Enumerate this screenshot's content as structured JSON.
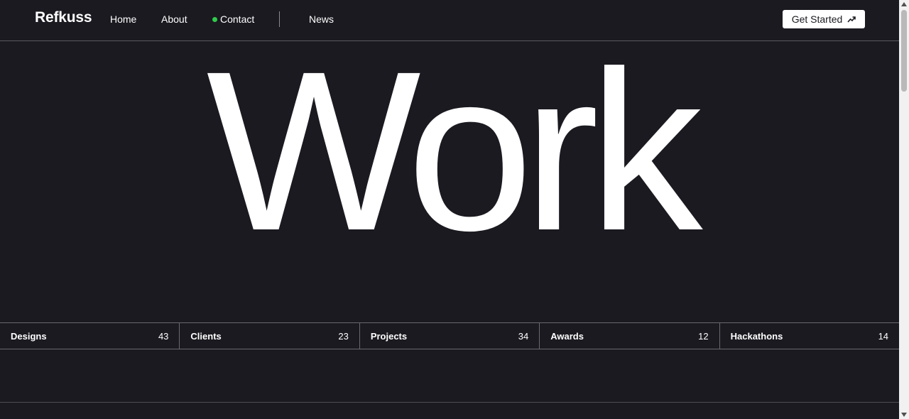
{
  "nav": {
    "brand": "Refkuss",
    "links": {
      "home": "Home",
      "about": "About",
      "contact": "Contact",
      "news": "News"
    },
    "contact_status_color": "#2ecc4a",
    "cta_label": "Get Started",
    "cta_icon": "trending-up-icon"
  },
  "hero": {
    "title": "Work"
  },
  "stats": [
    {
      "label": "Designs",
      "count": "43"
    },
    {
      "label": "Clients",
      "count": "23"
    },
    {
      "label": "Projects",
      "count": "34"
    },
    {
      "label": "Awards",
      "count": "12"
    },
    {
      "label": "Hackathons",
      "count": "14"
    }
  ],
  "colors": {
    "background": "#1b1a20",
    "text": "#ffffff",
    "accent_dot": "#2ecc4a"
  }
}
